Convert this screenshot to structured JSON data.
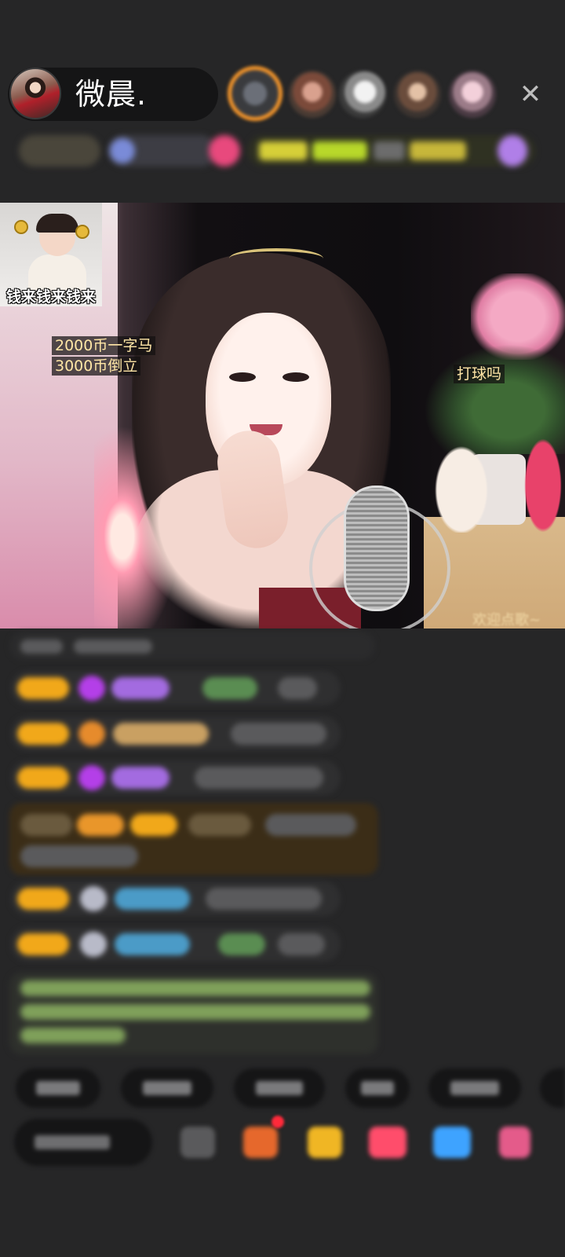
{
  "header": {
    "host_name": "微晨.",
    "close_label": "✕",
    "viewer_avatars": [
      "avatar",
      "avatar",
      "avatar",
      "avatar",
      "avatar"
    ]
  },
  "video": {
    "thumbnail_caption": "钱来钱来钱来",
    "notes": [
      "2000币一字马",
      "3000币倒立",
      "打球吗"
    ],
    "welcome_text": "欢迎点歌~"
  },
  "chat": {
    "message_count": 9
  },
  "quick_replies_count": 6,
  "bottom_bar": {
    "tools": [
      "more-icon",
      "gift-box-icon",
      "wallet-icon",
      "red-packet-icon",
      "chat-bubble-icon",
      "grid-icon"
    ]
  }
}
